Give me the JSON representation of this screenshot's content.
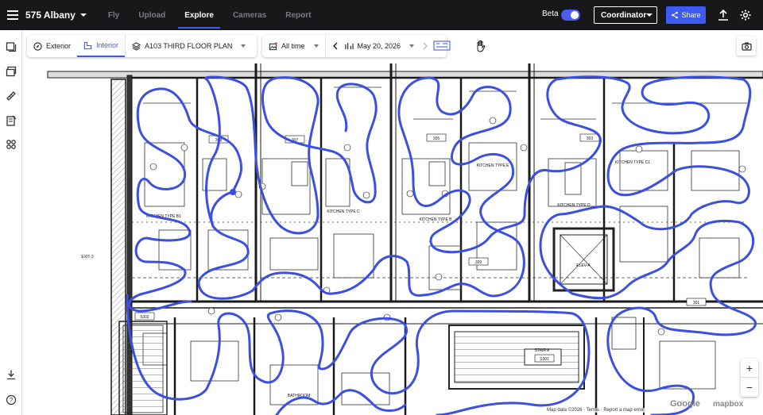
{
  "topbar": {
    "project": "575 Albany",
    "tabs": [
      {
        "label": "Fly",
        "active": false
      },
      {
        "label": "Upload",
        "active": false
      },
      {
        "label": "Explore",
        "active": true
      },
      {
        "label": "Cameras",
        "active": false
      },
      {
        "label": "Report",
        "active": false
      }
    ],
    "beta_label": "Beta",
    "beta_enabled": true,
    "role": "Coordinator",
    "share_label": "Share"
  },
  "toolbar": {
    "exterior_label": "Exterior",
    "interior_label": "Interior",
    "floor_label": "A103 THIRD FLOOR PLAN",
    "time_label": "All time",
    "date_label": "May 20, 2026"
  },
  "plan": {
    "rooms": [
      {
        "id": "308",
        "label": "BED 1"
      },
      {
        "id": "307",
        "label": "BED 1"
      },
      {
        "id": "305",
        "label": "BED 1"
      },
      {
        "id": "303",
        "label": "BED 1"
      },
      {
        "id": "309",
        "label": "BED 1"
      },
      {
        "id": "301",
        "label": "BED 1"
      },
      {
        "id": "5302",
        "label": "STAIR"
      },
      {
        "id": "S301",
        "label": "STAIR A"
      }
    ],
    "labels": {
      "kitchen_b1": "KITCHEN TYPE B1",
      "kitchen_b": "KITCHEN TYPE B",
      "kitchen_c": "KITCHEN TYPE C",
      "kitchen_c1": "KITCHEN TYPE C1",
      "kitchen_d": "KITCHEN TYPE D",
      "kitchen_e": "KITCHEN TYPE E",
      "elev": "ELEV-A",
      "bath": "BATHROOM",
      "stair": "STAIR A",
      "stair_num": "S301",
      "exit": "EXIT-3"
    }
  },
  "map_footer": {
    "attribution": "Map data ©2026 · Terms · Report a map error",
    "google": "Google",
    "mapbox": "mapbox",
    "zoom_in": "+",
    "zoom_out": "−"
  },
  "colors": {
    "accent": "#3d5af1",
    "path": "#3b4fe0",
    "topbar": "#18181b"
  }
}
